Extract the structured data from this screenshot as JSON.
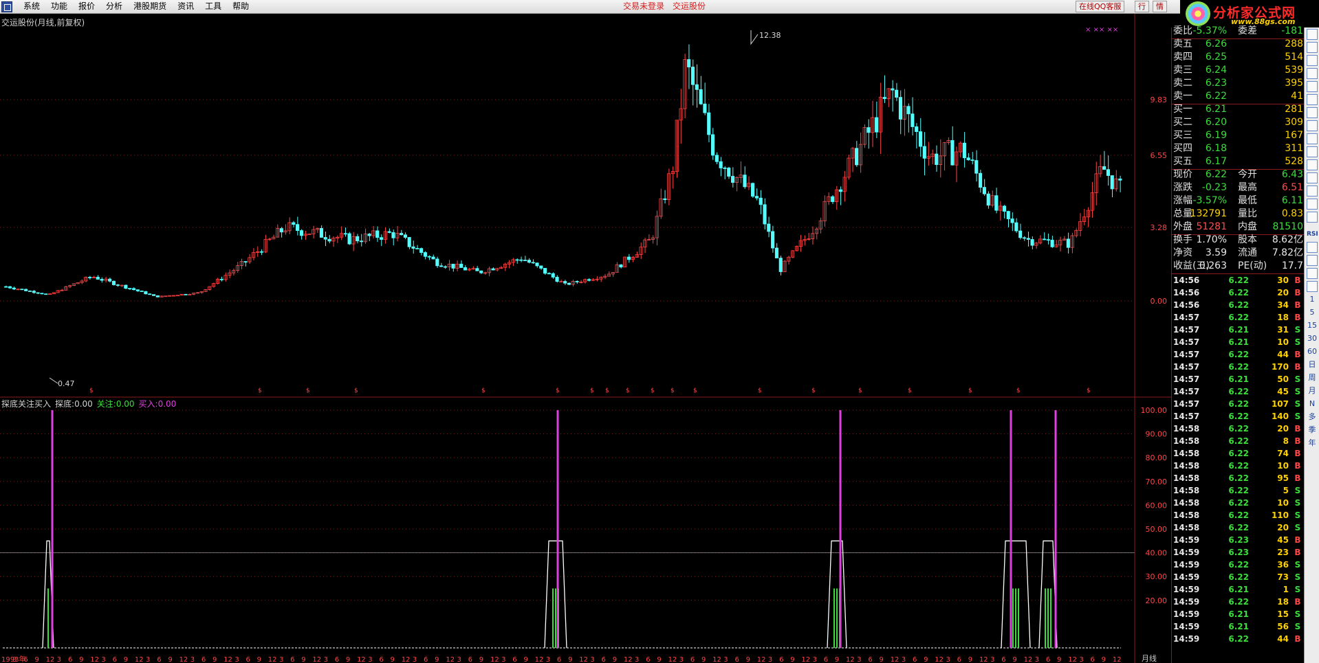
{
  "menu": {
    "items": [
      "系统",
      "功能",
      "报价",
      "分析",
      "港股期货",
      "资讯",
      "工具",
      "帮助"
    ],
    "status_login": "交易未登录",
    "status_stock": "交运股份",
    "service_button": "在线QQ客服",
    "hq_button": "行",
    "info_button": "情"
  },
  "brand": {
    "title": "分析家公式网",
    "url": "www.88gs.com"
  },
  "chart": {
    "title": "交运股份(月线,前复权)",
    "price_labels": [
      "9.83",
      "6.55",
      "3.28",
      "0.00"
    ],
    "high_marker": "12.38",
    "low_marker": "0.47",
    "period": "月线",
    "x_labels": [
      "1993年",
      "3",
      "6",
      "9",
      "12",
      "3",
      "6",
      "9",
      "12",
      "3",
      "6",
      "9",
      "12",
      "3",
      "6",
      "9",
      "12",
      "3",
      "6",
      "9",
      "12",
      "3",
      "6",
      "9",
      "12",
      "3",
      "6",
      "9",
      "12",
      "3",
      "6",
      "9",
      "12",
      "3",
      "6",
      "9",
      "12",
      "3",
      "6",
      "9",
      "12",
      "3",
      "6",
      "9",
      "12",
      "3",
      "6",
      "9",
      "12",
      "3",
      "6",
      "9",
      "12",
      "3",
      "6",
      "9",
      "12",
      "3",
      "6",
      "9",
      "12",
      "3",
      "6",
      "9",
      "12",
      "3",
      "6",
      "9",
      "12",
      "3",
      "6",
      "9",
      "12",
      "3",
      "6",
      "9",
      "12",
      "3",
      "6",
      "9",
      "12",
      "3",
      "6",
      "9",
      "12",
      "3",
      "6",
      "9",
      "12",
      "3",
      "6",
      "9",
      "12",
      "3",
      "6",
      "9",
      "12",
      "3",
      "6",
      "9",
      "12"
    ]
  },
  "indicator": {
    "name": "探底关注买入",
    "label_tandi": "探底:",
    "value_tandi": "0.00",
    "label_guanzhu": "关注:",
    "value_guanzhu": "0.00",
    "label_mairu": "买入:",
    "value_mairu": "0.00",
    "axis_labels": [
      "100.00",
      "90.00",
      "80.00",
      "70.00",
      "60.00",
      "50.00",
      "40.00",
      "30.00",
      "20.00"
    ]
  },
  "quote": {
    "top_row": {
      "label1": "委比",
      "value1": "-5.37%",
      "label2": "委差",
      "value2": "-181"
    },
    "asks": [
      {
        "label": "卖五",
        "price": "6.26",
        "vol": "288"
      },
      {
        "label": "卖四",
        "price": "6.25",
        "vol": "514"
      },
      {
        "label": "卖三",
        "price": "6.24",
        "vol": "539"
      },
      {
        "label": "卖二",
        "price": "6.23",
        "vol": "395"
      },
      {
        "label": "卖一",
        "price": "6.22",
        "vol": "41"
      }
    ],
    "bids": [
      {
        "label": "买一",
        "price": "6.21",
        "vol": "281"
      },
      {
        "label": "买二",
        "price": "6.20",
        "vol": "309"
      },
      {
        "label": "买三",
        "price": "6.19",
        "vol": "167"
      },
      {
        "label": "买四",
        "price": "6.18",
        "vol": "311"
      },
      {
        "label": "买五",
        "price": "6.17",
        "vol": "528"
      }
    ],
    "stats": [
      {
        "l1": "现价",
        "v1": "6.22",
        "c1": "green",
        "l2": "今开",
        "v2": "6.43",
        "c2": "green"
      },
      {
        "l1": "涨跌",
        "v1": "-0.23",
        "c1": "green",
        "l2": "最高",
        "v2": "6.51",
        "c2": "red"
      },
      {
        "l1": "涨幅",
        "v1": "-3.57%",
        "c1": "green",
        "l2": "最低",
        "v2": "6.11",
        "c2": "green"
      },
      {
        "l1": "总量",
        "v1": "132791",
        "c1": "yellow",
        "l2": "量比",
        "v2": "0.83",
        "c2": "yellow"
      },
      {
        "l1": "外盘",
        "v1": "51281",
        "c1": "red",
        "l2": "内盘",
        "v2": "81510",
        "c2": "green"
      }
    ],
    "finance": [
      {
        "l1": "换手",
        "v1": "1.70%",
        "l2": "股本",
        "v2": "8.62亿"
      },
      {
        "l1": "净资",
        "v1": "3.59",
        "l2": "流通",
        "v2": "7.82亿"
      },
      {
        "l1": "收益(三)",
        "v1": "0.263",
        "l2": "PE(动)",
        "v2": "17.7"
      }
    ],
    "ticks": [
      {
        "time": "14:56",
        "price": "6.22",
        "vol": "30",
        "dir": "B"
      },
      {
        "time": "14:56",
        "price": "6.22",
        "vol": "20",
        "dir": "B"
      },
      {
        "time": "14:56",
        "price": "6.22",
        "vol": "34",
        "dir": "B"
      },
      {
        "time": "14:57",
        "price": "6.22",
        "vol": "18",
        "dir": "B"
      },
      {
        "time": "14:57",
        "price": "6.21",
        "vol": "31",
        "dir": "S"
      },
      {
        "time": "14:57",
        "price": "6.21",
        "vol": "10",
        "dir": "S"
      },
      {
        "time": "14:57",
        "price": "6.22",
        "vol": "44",
        "dir": "B"
      },
      {
        "time": "14:57",
        "price": "6.22",
        "vol": "170",
        "dir": "B"
      },
      {
        "time": "14:57",
        "price": "6.21",
        "vol": "50",
        "dir": "S"
      },
      {
        "time": "14:57",
        "price": "6.22",
        "vol": "45",
        "dir": "S"
      },
      {
        "time": "14:57",
        "price": "6.22",
        "vol": "107",
        "dir": "S"
      },
      {
        "time": "14:57",
        "price": "6.22",
        "vol": "140",
        "dir": "S"
      },
      {
        "time": "14:58",
        "price": "6.22",
        "vol": "20",
        "dir": "B"
      },
      {
        "time": "14:58",
        "price": "6.22",
        "vol": "8",
        "dir": "B"
      },
      {
        "time": "14:58",
        "price": "6.22",
        "vol": "74",
        "dir": "B"
      },
      {
        "time": "14:58",
        "price": "6.22",
        "vol": "10",
        "dir": "B"
      },
      {
        "time": "14:58",
        "price": "6.22",
        "vol": "95",
        "dir": "B"
      },
      {
        "time": "14:58",
        "price": "6.22",
        "vol": "5",
        "dir": "S"
      },
      {
        "time": "14:58",
        "price": "6.22",
        "vol": "10",
        "dir": "S"
      },
      {
        "time": "14:58",
        "price": "6.22",
        "vol": "110",
        "dir": "S"
      },
      {
        "time": "14:58",
        "price": "6.22",
        "vol": "20",
        "dir": "S"
      },
      {
        "time": "14:59",
        "price": "6.23",
        "vol": "45",
        "dir": "B"
      },
      {
        "time": "14:59",
        "price": "6.23",
        "vol": "23",
        "dir": "B"
      },
      {
        "time": "14:59",
        "price": "6.22",
        "vol": "36",
        "dir": "S"
      },
      {
        "time": "14:59",
        "price": "6.22",
        "vol": "73",
        "dir": "S"
      },
      {
        "time": "14:59",
        "price": "6.21",
        "vol": "1",
        "dir": "S"
      },
      {
        "time": "14:59",
        "price": "6.22",
        "vol": "18",
        "dir": "B"
      },
      {
        "time": "14:59",
        "price": "6.21",
        "vol": "15",
        "dir": "S"
      },
      {
        "time": "14:59",
        "price": "6.21",
        "vol": "56",
        "dir": "S"
      },
      {
        "time": "14:59",
        "price": "6.22",
        "vol": "44",
        "dir": "B"
      }
    ]
  },
  "toolbar": {
    "items": [
      "RSI",
      "1",
      "5",
      "15",
      "30",
      "60",
      "日",
      "周",
      "月",
      "N",
      "多",
      "季",
      "年"
    ]
  },
  "colors": {
    "up": "#ff4646",
    "down": "#54ffff",
    "grid": "#8a1a1a",
    "buy_line": "#e040e0",
    "attention": "#3cde3c",
    "bottom": "#ffffff"
  }
}
